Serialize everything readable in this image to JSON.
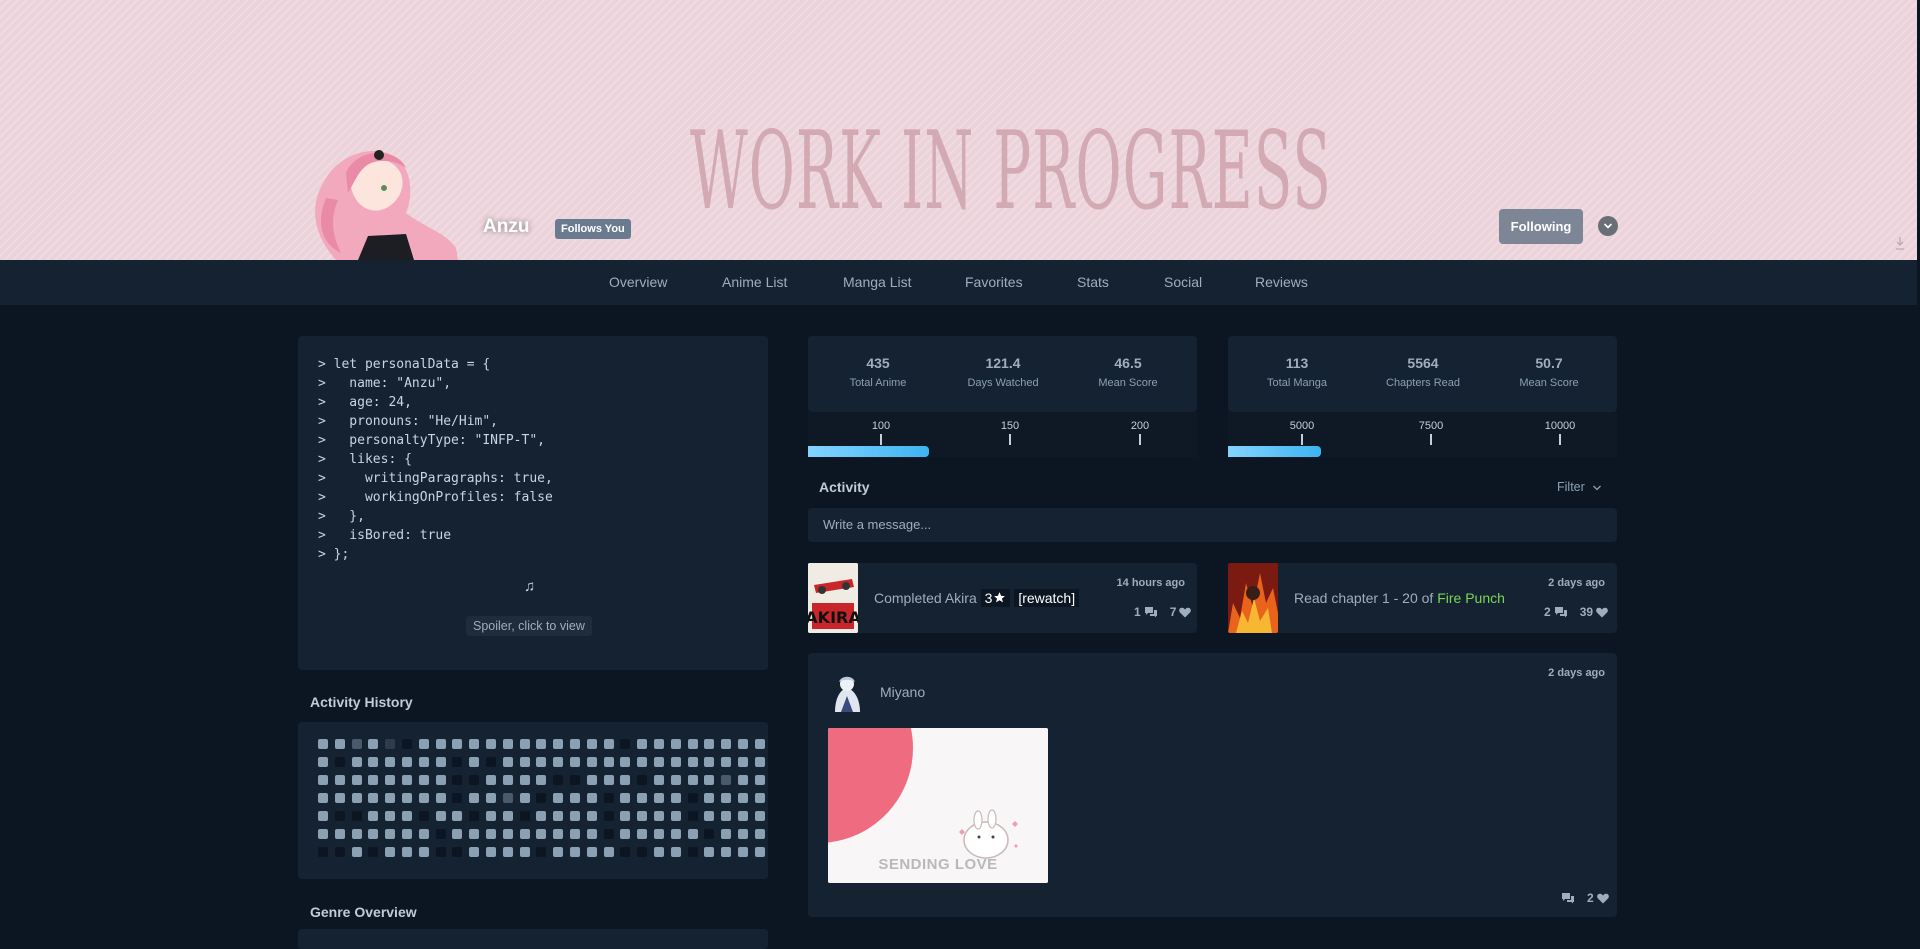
{
  "banner": {
    "title": "WORK IN PROGRESS",
    "username": "Anzu",
    "follows_badge": "Follows You",
    "following_button": "Following"
  },
  "nav": {
    "items": [
      "Overview",
      "Anime List",
      "Manga List",
      "Favorites",
      "Stats",
      "Social",
      "Reviews"
    ]
  },
  "about": {
    "code_lines": [
      "> let personalData = {",
      ">   name: \"Anzu\",",
      ">   age: 24,",
      ">   pronouns: \"He/Him\",",
      ">   personaltyType: \"INFP-T\",",
      ">   likes: {",
      ">     writingParagraphs: true,",
      ">     workingOnProfiles: false",
      ">   },",
      ">   isBored: true",
      "> };"
    ],
    "music_glyph": "♫",
    "spoiler": "Spoiler, click to view"
  },
  "activity_history": {
    "title": "Activity History",
    "levels": [
      [
        1,
        1,
        2,
        1,
        3,
        0,
        1,
        1,
        1,
        1,
        1,
        1,
        1,
        1,
        1,
        1,
        1,
        1,
        0,
        1,
        1,
        1,
        1,
        1,
        1,
        1,
        1
      ],
      [
        1,
        0,
        1,
        1,
        1,
        1,
        1,
        1,
        0,
        1,
        0,
        1,
        1,
        1,
        1,
        1,
        1,
        1,
        1,
        1,
        1,
        1,
        1,
        1,
        1,
        1,
        1
      ],
      [
        1,
        1,
        1,
        1,
        1,
        1,
        1,
        1,
        0,
        0,
        1,
        1,
        1,
        1,
        0,
        0,
        1,
        1,
        1,
        0,
        1,
        1,
        1,
        1,
        2,
        1,
        1
      ],
      [
        1,
        1,
        1,
        1,
        1,
        1,
        1,
        1,
        0,
        1,
        1,
        2,
        1,
        0,
        1,
        1,
        1,
        0,
        1,
        1,
        1,
        1,
        0,
        1,
        1,
        1,
        1
      ],
      [
        1,
        0,
        0,
        1,
        1,
        1,
        0,
        1,
        1,
        0,
        1,
        1,
        0,
        1,
        1,
        1,
        1,
        0,
        1,
        1,
        1,
        1,
        0,
        1,
        1,
        1,
        1
      ],
      [
        1,
        1,
        1,
        1,
        1,
        1,
        1,
        0,
        1,
        1,
        1,
        1,
        1,
        1,
        1,
        1,
        1,
        0,
        1,
        1,
        1,
        1,
        1,
        0,
        1,
        1,
        1
      ],
      [
        0,
        0,
        1,
        0,
        1,
        1,
        1,
        0,
        0,
        1,
        1,
        1,
        1,
        0,
        1,
        1,
        1,
        1,
        0,
        0,
        1,
        1,
        0,
        1,
        1,
        1,
        1
      ]
    ]
  },
  "genre_overview": {
    "title": "Genre Overview"
  },
  "anime_stats": {
    "items": [
      {
        "value": "435",
        "label": "Total Anime"
      },
      {
        "value": "121.4",
        "label": "Days Watched"
      },
      {
        "value": "46.5",
        "label": "Mean Score"
      }
    ],
    "milestones": [
      "100",
      "150",
      "200"
    ],
    "progress_fraction": 0.31
  },
  "manga_stats": {
    "items": [
      {
        "value": "113",
        "label": "Total Manga"
      },
      {
        "value": "5564",
        "label": "Chapters Read"
      },
      {
        "value": "50.7",
        "label": "Mean Score"
      }
    ],
    "milestones": [
      "5000",
      "7500",
      "10000"
    ],
    "progress_fraction": 0.24
  },
  "activity": {
    "title": "Activity",
    "filter_label": "Filter",
    "message_placeholder": "Write a message...",
    "entries": [
      {
        "prefix": "Completed ",
        "title": "Akira",
        "rating": "3",
        "rewatch": "[rewatch]",
        "time": "14 hours ago",
        "replies": "1",
        "likes": "7"
      },
      {
        "prefix": "Read chapter 1 - 20 of ",
        "title": "Fire Punch",
        "time": "2 days ago",
        "replies": "2",
        "likes": "39"
      }
    ],
    "message": {
      "user": "Miyano",
      "time": "2 days ago",
      "image_caption": "SENDING LOVE",
      "likes": "2"
    }
  },
  "colors": {
    "background": "#0b1622",
    "card": "#152232",
    "accent": "#3db4f2",
    "link_green": "#7bd555",
    "banner": "#efd7de"
  }
}
